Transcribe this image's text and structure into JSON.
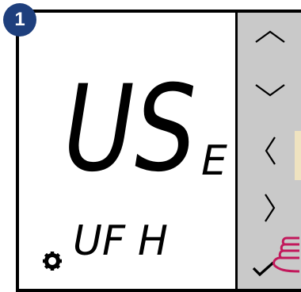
{
  "step": {
    "number": "1"
  },
  "display": {
    "main_text": "US",
    "suffix_text": "E",
    "sub_text": "UF H",
    "settings_icon": "gear-icon"
  },
  "keypad": {
    "buttons": [
      {
        "name": "up-arrow-button",
        "icon": "chevron-up-icon"
      },
      {
        "name": "down-arrow-button",
        "icon": "chevron-down-icon"
      },
      {
        "name": "left-arrow-button",
        "icon": "chevron-left-icon"
      },
      {
        "name": "right-arrow-button",
        "icon": "chevron-right-icon"
      },
      {
        "name": "confirm-button",
        "icon": "check-icon"
      }
    ]
  },
  "colors": {
    "badge": "#1e3f7d",
    "keypad_bg": "#c9c9c9",
    "finger": "#c2185b"
  }
}
